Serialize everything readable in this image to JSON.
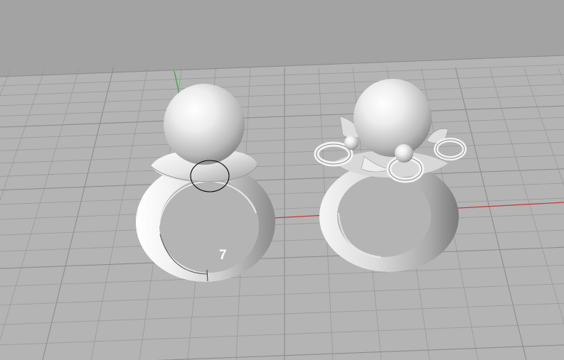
{
  "viewport": {
    "label": "7",
    "colors": {
      "background": "#a3a3a3",
      "grid_plane": "#b5b5b5",
      "grid_line": "#9a9a9a",
      "grid_major": "#8c8c8c",
      "x_axis": "#c43a3a",
      "y_axis": "#2eaa2e",
      "selection_curve": "#000000"
    },
    "objects": [
      "ring-with-sphere",
      "ring-with-sphere-and-ornaments"
    ]
  }
}
